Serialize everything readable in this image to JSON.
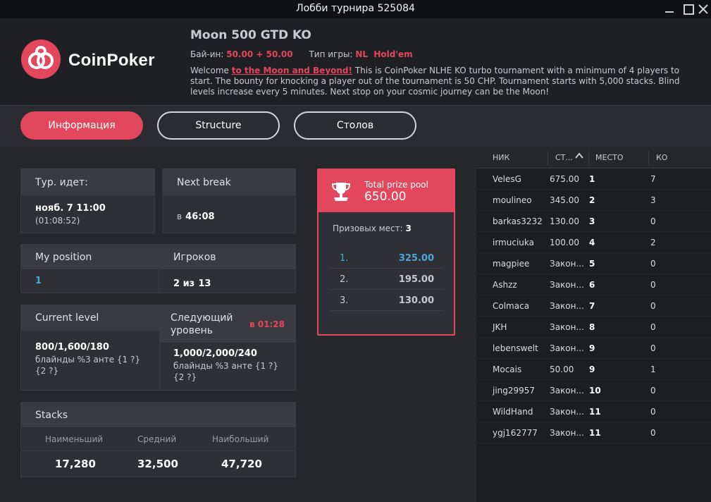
{
  "window": {
    "title": "Лобби турнира 525084"
  },
  "brand": {
    "name": "CoinPoker",
    "accent": "#e2475d"
  },
  "tournament": {
    "name": "Moon 500 GTD KO",
    "buyin_label": "Бай-ин:",
    "buyin_value": "50.00 + 50.00",
    "gametype_label": "Тип игры:",
    "gametype_value": "NL  Hold'em",
    "desc_pre": "Welcome ",
    "desc_link": "to the Moon and Beyond!",
    "desc_post": " This is CoinPoker NLHE KO turbo tournament with a minimum of 4 players to start. The bounty for knocking a player out of the tournament is 50 CHP. Tournament starts with 5,000 stacks. Blind levels increase every 5 minutes. Next stop on your cosmic journey can be the Moon!"
  },
  "tabs": [
    "Информация",
    "Structure",
    "Столов"
  ],
  "info": {
    "running_label": "Тур. идет:",
    "running_date": "нояб. 7 11:00",
    "running_elapsed": "(01:08:52)",
    "break_label": "Next break",
    "break_prefix": "в",
    "break_time": "46:08",
    "position_label": "My position",
    "position_value": "1",
    "players_label": "Игроков",
    "players_prefix": "2 из",
    "players_value": "13",
    "level_label": "Current level",
    "level_value": "800/1,600/180",
    "level_desc1": "блайнды %3 анте {1 ?}",
    "level_desc2": "{2 ?}",
    "next_level_label": "Следующий уровень",
    "next_level_timer": "в 01:28",
    "next_level_value": "1,000/2,000/240",
    "next_level_desc1": "блайнды %3 анте {1 ?}",
    "next_level_desc2": "{2 ?}",
    "stacks_label": "Stacks",
    "stacks_cols": [
      "Наименьший",
      "Средний",
      "Наибольший"
    ],
    "stacks_values": [
      "17,280",
      "32,500",
      "47,720"
    ]
  },
  "prize": {
    "label": "Total prize pool",
    "amount": "650.00",
    "places_label": "Призовых мест:",
    "places_value": "3",
    "rows": [
      {
        "place": "1.",
        "amount": "325.00"
      },
      {
        "place": "2.",
        "amount": "195.00"
      },
      {
        "place": "3.",
        "amount": "130.00"
      }
    ]
  },
  "players": {
    "columns": [
      "НИК",
      "СТ...",
      "МЕСТО",
      "КО"
    ],
    "rows": [
      {
        "nick": "VelesG",
        "stack": "675.00",
        "place": "1",
        "ko": "7"
      },
      {
        "nick": "moulineo",
        "stack": "345.00",
        "place": "2",
        "ko": "3"
      },
      {
        "nick": "barkas3232",
        "stack": "130.00",
        "place": "3",
        "ko": "0"
      },
      {
        "nick": "irmuciuka",
        "stack": "100.00",
        "place": "4",
        "ko": "2"
      },
      {
        "nick": "magpiee",
        "stack": "Закон...",
        "place": "5",
        "ko": "0"
      },
      {
        "nick": "Ashzz",
        "stack": "Закон...",
        "place": "6",
        "ko": "0"
      },
      {
        "nick": "Colmaca",
        "stack": "Закон...",
        "place": "7",
        "ko": "0"
      },
      {
        "nick": "JKH",
        "stack": "Закон...",
        "place": "8",
        "ko": "0"
      },
      {
        "nick": "lebenswelt",
        "stack": "Закон...",
        "place": "9",
        "ko": "0"
      },
      {
        "nick": "Mocais",
        "stack": "50.00",
        "place": "9",
        "ko": "1"
      },
      {
        "nick": "jing29957",
        "stack": "Закон...",
        "place": "10",
        "ko": "0"
      },
      {
        "nick": "WildHand",
        "stack": "Закон...",
        "place": "11",
        "ko": "0"
      },
      {
        "nick": "ygj162777",
        "stack": "Закон...",
        "place": "11",
        "ko": "0"
      }
    ]
  }
}
